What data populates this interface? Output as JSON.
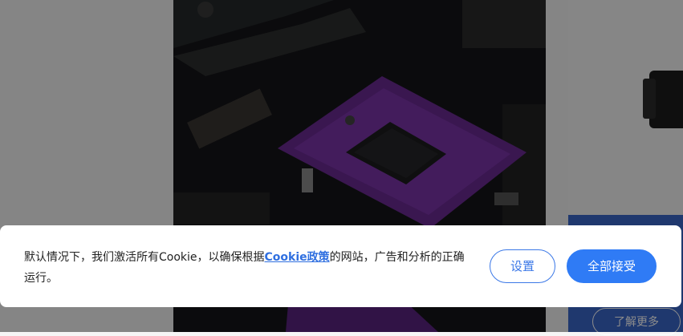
{
  "background": {
    "learn_more_label": "了解更多"
  },
  "cookie_banner": {
    "text_before": "默认情况下，我们激活所有Cookie，以确保根据",
    "policy_link": "Cookie政策",
    "text_after": "的网站，广告和分析的正确运行。",
    "settings_label": "设置",
    "accept_all_label": "全部接受"
  },
  "colors": {
    "accent": "#2f7bf5",
    "link": "#2f6fe0",
    "side_panel_blue": "#3a66c8"
  }
}
